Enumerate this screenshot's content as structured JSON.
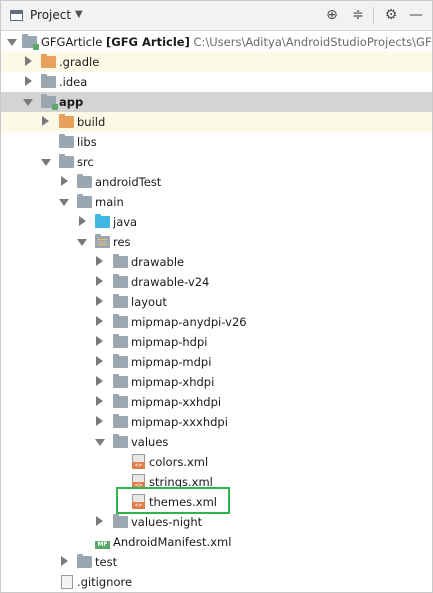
{
  "toolbar": {
    "title": "Project",
    "dropdown_icon": "chevron-down-icon",
    "buttons": [
      "locate-icon",
      "collapse-all-icon",
      "settings-gear-icon",
      "hide-icon"
    ]
  },
  "tree": {
    "root": {
      "name": "GFGArticle",
      "bold_suffix": "[GFG Article]",
      "path": "C:\\Users\\Aditya\\AndroidStudioProjects\\GFGArtic"
    },
    "items": [
      {
        "label": ".gradle"
      },
      {
        "label": ".idea"
      },
      {
        "label": "app"
      },
      {
        "label": "build"
      },
      {
        "label": "libs"
      },
      {
        "label": "src"
      },
      {
        "label": "androidTest"
      },
      {
        "label": "main"
      },
      {
        "label": "java"
      },
      {
        "label": "res"
      },
      {
        "label": "drawable"
      },
      {
        "label": "drawable-v24"
      },
      {
        "label": "layout"
      },
      {
        "label": "mipmap-anydpi-v26"
      },
      {
        "label": "mipmap-hdpi"
      },
      {
        "label": "mipmap-mdpi"
      },
      {
        "label": "mipmap-xhdpi"
      },
      {
        "label": "mipmap-xxhdpi"
      },
      {
        "label": "mipmap-xxxhdpi"
      },
      {
        "label": "values"
      },
      {
        "label": "colors.xml"
      },
      {
        "label": "strings.xml"
      },
      {
        "label": "themes.xml"
      },
      {
        "label": "values-night"
      },
      {
        "label": "AndroidManifest.xml",
        "icon_badge": "MF"
      },
      {
        "label": "test"
      },
      {
        "label": ".gitignore"
      }
    ]
  },
  "colors": {
    "highlight_border": "#2fb54a",
    "selected_row": "#d4d4d4",
    "excluded_row": "#fcfae6",
    "folder": "#9aa7b0",
    "folder_excluded": "#e8a15c",
    "folder_source": "#40b6e0"
  }
}
